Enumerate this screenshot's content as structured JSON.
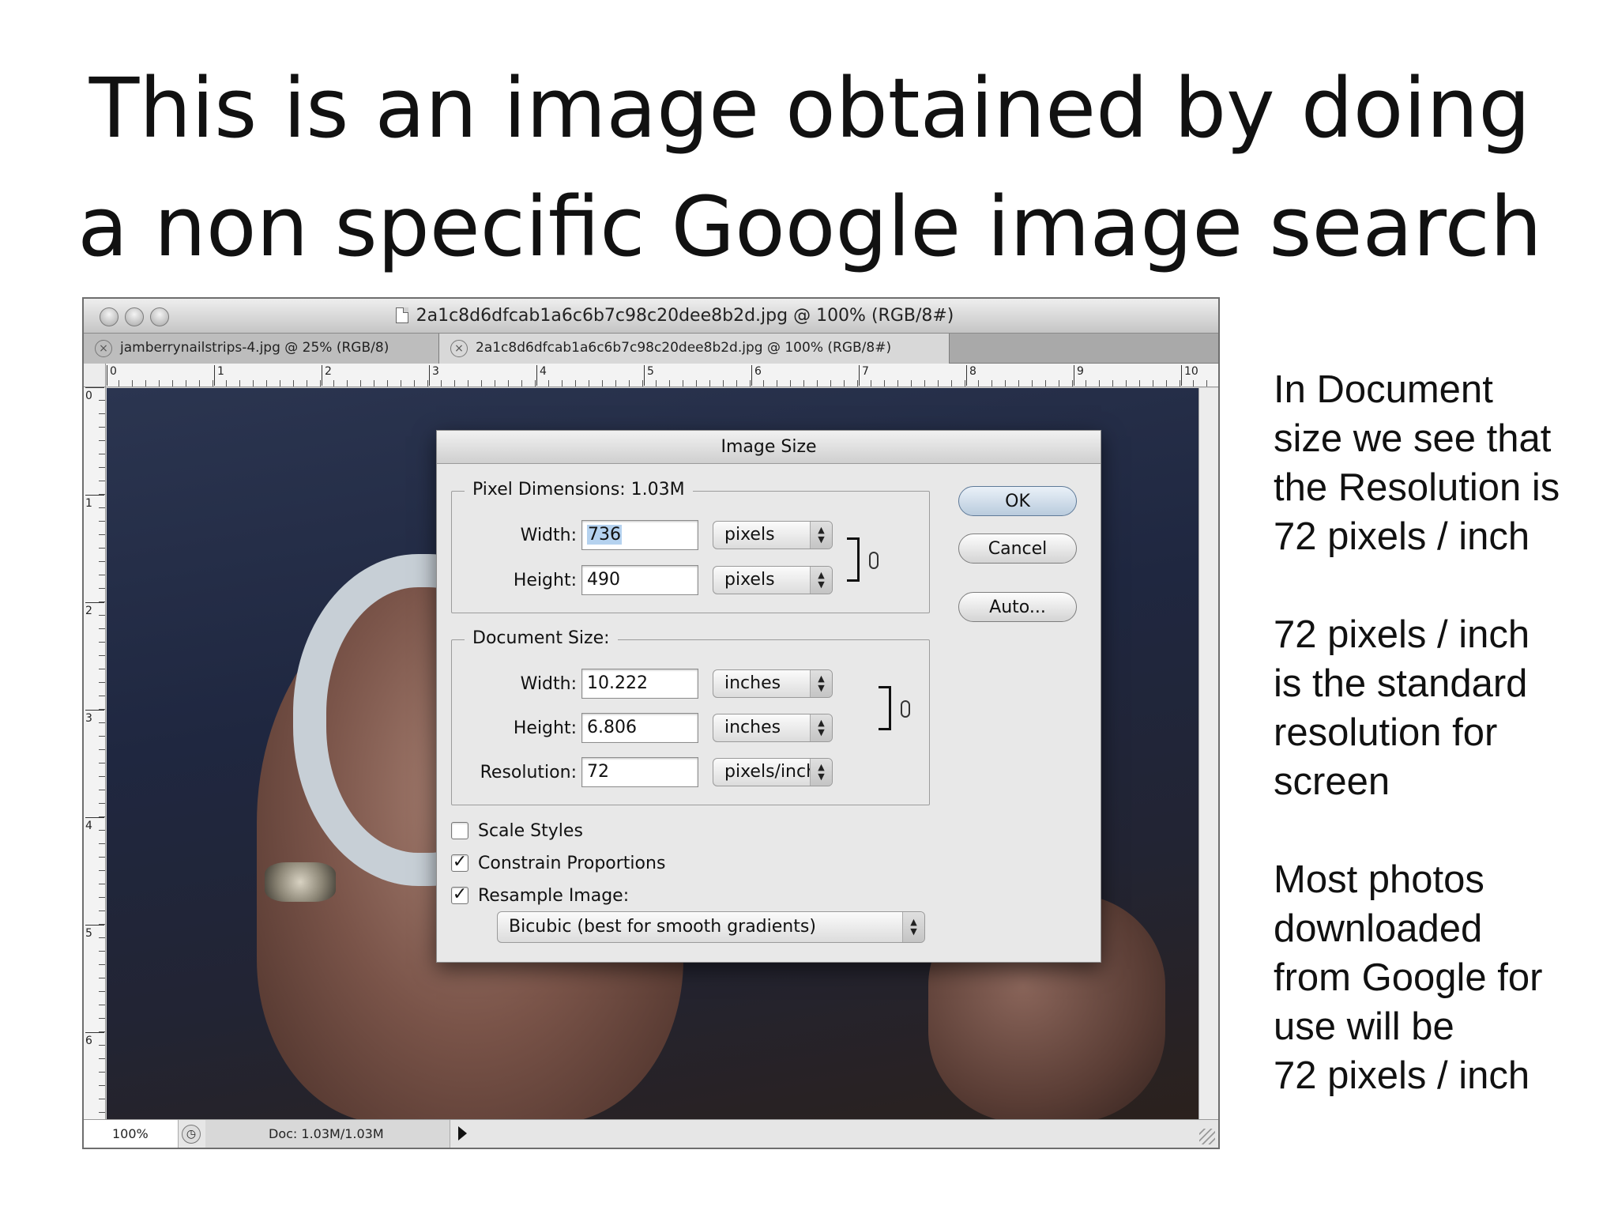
{
  "slide": {
    "title_line1": "This is an image obtained by doing",
    "title_line2": "a non specific Google image search",
    "notes": [
      [
        "In Document",
        "size we see that",
        "the Resolution is",
        "72 pixels / inch"
      ],
      [
        "72 pixels / inch",
        "is the standard",
        "resolution for",
        "screen"
      ],
      [
        "Most photos",
        "downloaded",
        "from Google for",
        "use will be",
        "72 pixels / inch"
      ]
    ]
  },
  "window": {
    "title": "2a1c8d6dfcab1a6c6b7c98c20dee8b2d.jpg @ 100% (RGB/8#)",
    "tabs": [
      {
        "label": "jamberrynailstrips-4.jpg @ 25% (RGB/8)"
      },
      {
        "label": "2a1c8d6dfcab1a6c6b7c98c20dee8b2d.jpg @ 100% (RGB/8#)"
      }
    ],
    "ruler_h": [
      "0",
      "1",
      "2",
      "3",
      "4",
      "5",
      "6",
      "7",
      "8",
      "9",
      "10"
    ],
    "ruler_v": [
      "0",
      "1",
      "2",
      "3",
      "4",
      "5",
      "6"
    ],
    "status": {
      "zoom": "100%",
      "doc": "Doc: 1.03M/1.03M"
    }
  },
  "dialog": {
    "title": "Image Size",
    "pixel_dimensions": {
      "legend": "Pixel Dimensions:  1.03M",
      "width_label": "Width:",
      "width_value": "736",
      "width_unit": "pixels",
      "height_label": "Height:",
      "height_value": "490",
      "height_unit": "pixels"
    },
    "document_size": {
      "legend": "Document Size:",
      "width_label": "Width:",
      "width_value": "10.222",
      "width_unit": "inches",
      "height_label": "Height:",
      "height_value": "6.806",
      "height_unit": "inches",
      "resolution_label": "Resolution:",
      "resolution_value": "72",
      "resolution_unit": "pixels/inch"
    },
    "checkboxes": [
      {
        "label": "Scale Styles",
        "checked": false
      },
      {
        "label": "Constrain Proportions",
        "checked": true
      },
      {
        "label": "Resample Image:",
        "checked": true
      }
    ],
    "resample_method": "Bicubic (best for smooth gradients)",
    "buttons": {
      "ok": "OK",
      "cancel": "Cancel",
      "auto": "Auto..."
    },
    "check_glyph": "✓",
    "stepper_glyph": "▲▼",
    "link_bracket": "]"
  }
}
